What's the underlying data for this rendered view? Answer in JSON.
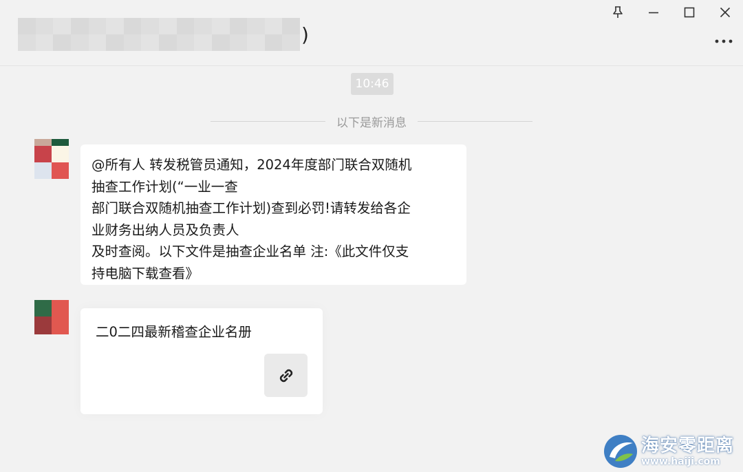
{
  "header": {
    "title_suffix": ")"
  },
  "window_controls": {
    "pin": "pin-icon",
    "minimize": "minimize-icon",
    "maximize": "maximize-icon",
    "close": "close-icon",
    "more": "more-icon"
  },
  "chat": {
    "timestamp": "10:46",
    "new_messages_label": "以下是新消息",
    "messages": [
      {
        "type": "text",
        "lines": [
          "@所有人 转发税管员通知，2024年度部门联合双随机",
          "抽查工作计划(“一业一查",
          "部门联合双随机抽查工作计划)查到必罚!请转发给各企",
          "业财务出纳人员及负责人",
          "及时查阅。以下文件是抽查企业名单 注:《此文件仅支",
          "持电脑下载查看》"
        ]
      },
      {
        "type": "link_card",
        "title": "二0二四最新稽查企业名册",
        "icon": "link-icon"
      }
    ]
  },
  "watermark": {
    "brand": "海安零距离",
    "url": "www.haiji.com"
  },
  "colors": {
    "background": "#f2f2f2",
    "bubble": "#ffffff",
    "timestamp_bg": "#dcdcdc",
    "divider_text": "#9a9a9a"
  }
}
